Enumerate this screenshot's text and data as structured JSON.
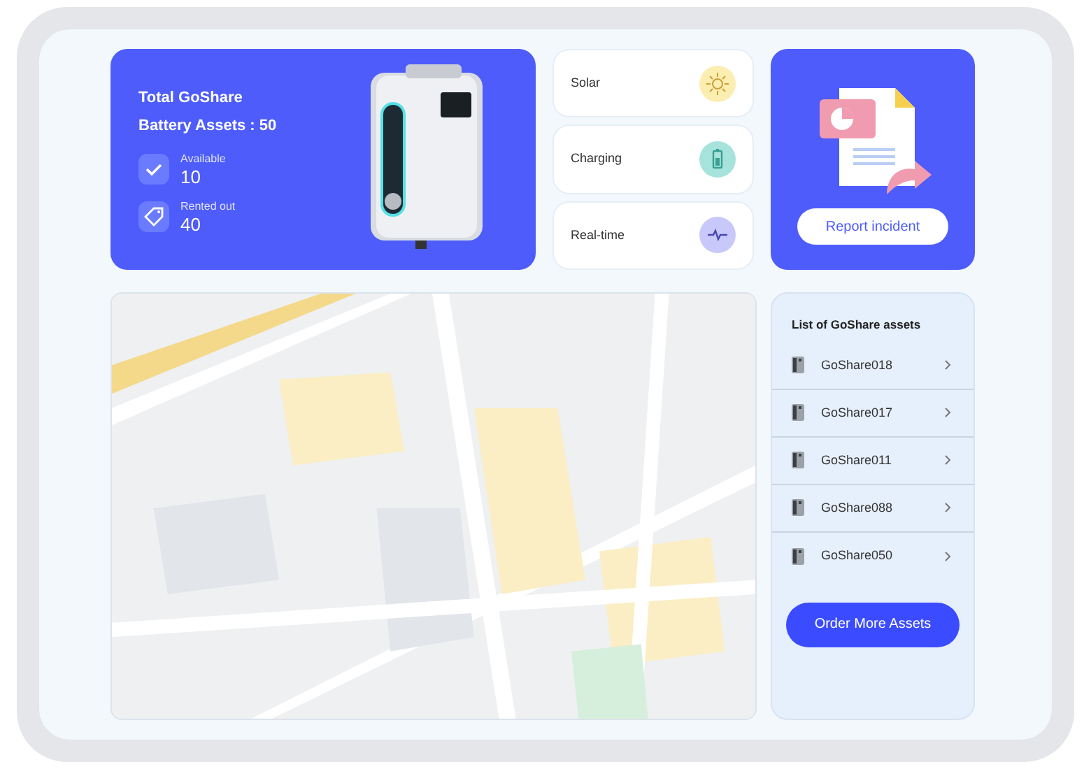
{
  "summary": {
    "title": "Total GoShare",
    "subtitle": "Battery Assets : 50",
    "stats": [
      {
        "kind": "available",
        "label": "Available",
        "value": "10"
      },
      {
        "kind": "rented",
        "label": "Rented out",
        "value": "40"
      }
    ]
  },
  "features": [
    {
      "kind": "solar",
      "label": "Solar",
      "color": "#fbeeb0"
    },
    {
      "kind": "charging",
      "label": "Charging",
      "color": "#a6e3dc"
    },
    {
      "kind": "realtime",
      "label": "Real-time",
      "color": "#c9c8fb"
    }
  ],
  "report": {
    "button": "Report incident"
  },
  "assets": {
    "title": "List of GoShare assets",
    "items": [
      {
        "name": "GoShare018"
      },
      {
        "name": "GoShare017"
      },
      {
        "name": "GoShare011"
      },
      {
        "name": "GoShare088"
      },
      {
        "name": "GoShare050"
      }
    ],
    "button": "Order More Assets"
  }
}
